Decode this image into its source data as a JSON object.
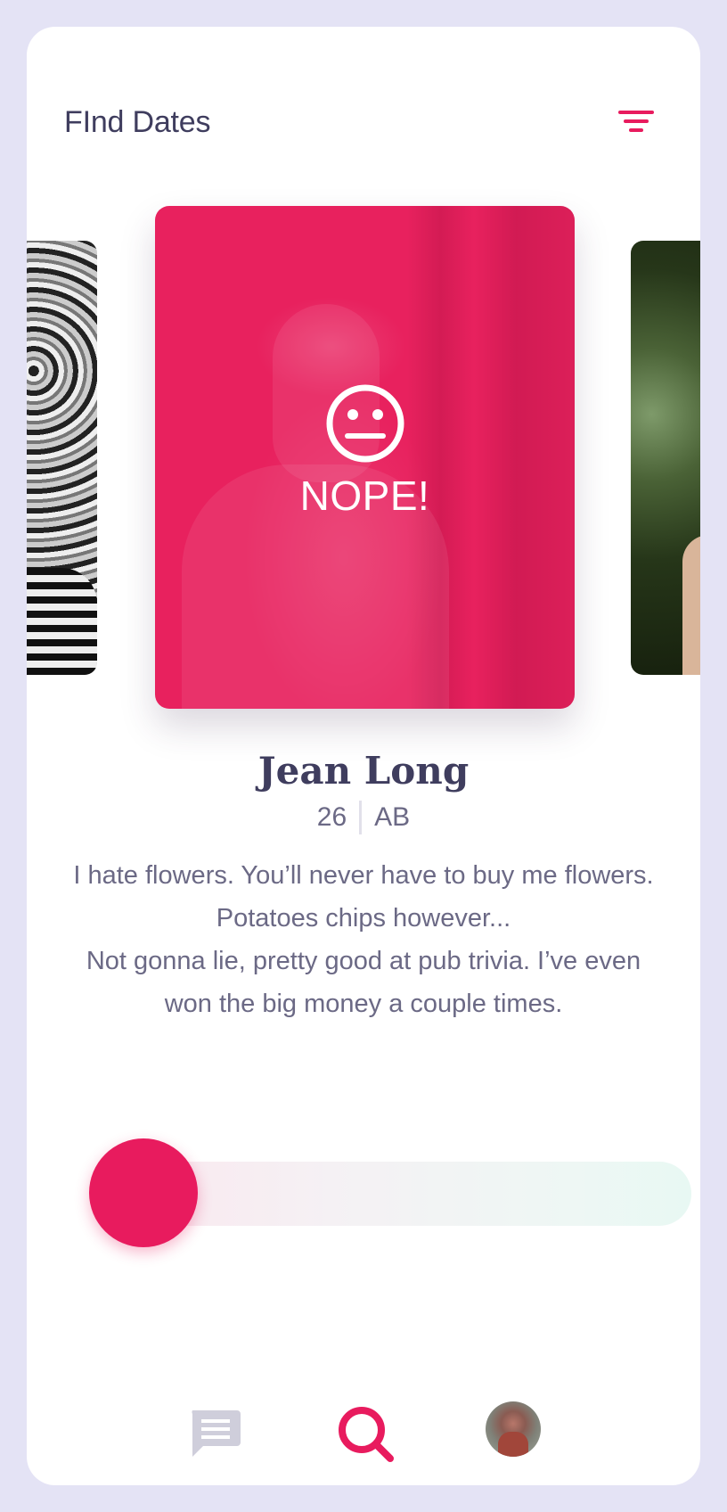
{
  "header": {
    "title": "FInd Dates",
    "filter_icon": "filter-icon"
  },
  "cards": {
    "main": {
      "status_text": "NOPE!",
      "status_icon": "neutral-face-icon",
      "tint_color": "#e8215e"
    }
  },
  "profile": {
    "name": "Jean Long",
    "age": "26",
    "province": "AB",
    "bio": [
      "I hate flowers. You’ll never have to buy me flowers. Potatoes chips however...",
      "Not gonna lie, pretty good at pub trivia. I’ve even won the big money a couple times."
    ]
  },
  "swipe_slider": {
    "position": 0.0,
    "knob_color": "#e81b5e"
  },
  "bottom_nav": {
    "items": [
      {
        "icon": "chat-icon",
        "active": false
      },
      {
        "icon": "search-icon",
        "active": true
      },
      {
        "icon": "avatar",
        "active": false
      }
    ]
  },
  "colors": {
    "accent": "#e81b5e",
    "text_dark": "#3f3d5e",
    "text_muted": "#6b6985",
    "frame": "#e4e3f5"
  }
}
